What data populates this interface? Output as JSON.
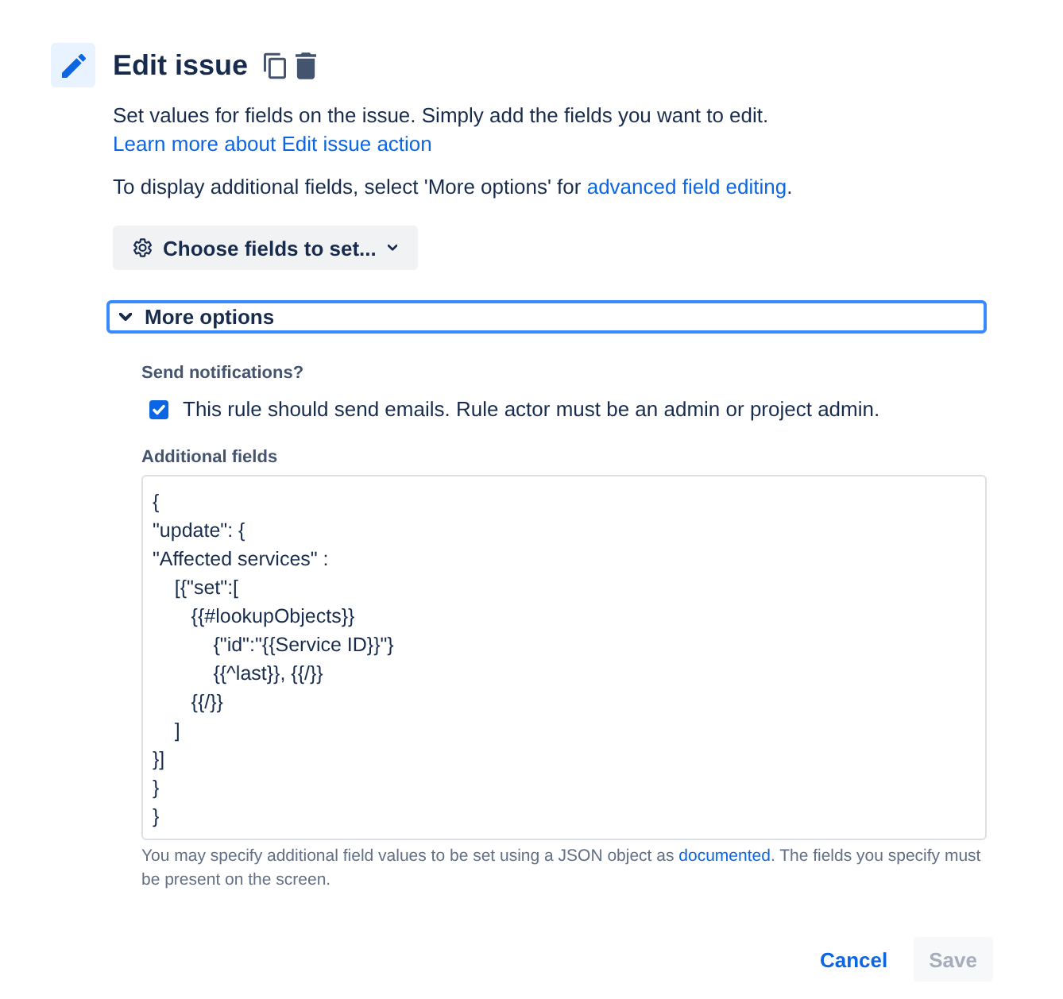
{
  "header": {
    "title": "Edit issue"
  },
  "description": {
    "text": "Set values for fields on the issue. Simply add the fields you want to edit.",
    "link": "Learn more about Edit issue action"
  },
  "hint": {
    "text_before": "To display additional fields, select 'More options' for",
    "link": "advanced field editing",
    "text_after": "."
  },
  "choose_fields_button": {
    "label": "Choose fields to set..."
  },
  "more_options": {
    "label": "More options",
    "expanded": true,
    "focused": true,
    "send_notifications": {
      "label": "Send notifications?",
      "checkbox": {
        "label": "This rule should send emails. Rule actor must be an admin or project admin.",
        "checked": true
      }
    },
    "additional_fields": {
      "label": "Additional fields",
      "value": "{\n\"update\": {\n\"Affected services\" :\n    [{\"set\":[\n       {{#lookupObjects}}\n           {\"id\":\"{{Service ID}}\"}\n           {{^last}}, {{/}}\n       {{/}}\n    ]\n}]\n}\n}",
      "help": {
        "text_before": "You may specify additional field values to be set using a JSON object as",
        "link": "documented",
        "text_after": ". The fields you specify must be present on the screen."
      }
    }
  },
  "actions": [
    {
      "label": "Cancel",
      "kind": "link",
      "disabled": false
    },
    {
      "label": "Save",
      "kind": "button",
      "disabled": true
    }
  ]
}
